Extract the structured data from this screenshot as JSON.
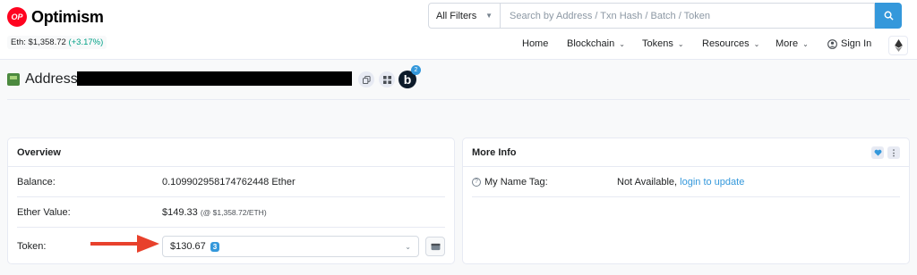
{
  "header": {
    "logo_badge": "OP",
    "logo_text": "Optimism",
    "eth_price_label": "Eth: $1,358.72",
    "eth_price_change": "(+3.17%)",
    "filter_label": "All Filters",
    "search_placeholder": "Search by Address / Txn Hash / Batch / Token"
  },
  "nav": {
    "home": "Home",
    "blockchain": "Blockchain",
    "tokens": "Tokens",
    "resources": "Resources",
    "more": "More",
    "sign_in": "Sign In"
  },
  "address": {
    "label": "Address",
    "blockscan_badge_letter": "b",
    "blockscan_badge_count": "2"
  },
  "overview": {
    "title": "Overview",
    "balance_label": "Balance:",
    "balance_value": "0.109902958174762448 Ether",
    "ether_value_label": "Ether Value:",
    "ether_value": "$149.33",
    "ether_value_rate": "(@ $1,358.72/ETH)",
    "token_label": "Token:",
    "token_value": "$130.67",
    "token_count": "3"
  },
  "more_info": {
    "title": "More Info",
    "name_tag_label": "My Name Tag:",
    "name_tag_value": "Not Available,",
    "name_tag_link": "login to update"
  },
  "colors": {
    "brand": "#ff0420",
    "accent": "#3498db",
    "positive": "#00a186",
    "annotation_arrow": "#e8412c"
  }
}
